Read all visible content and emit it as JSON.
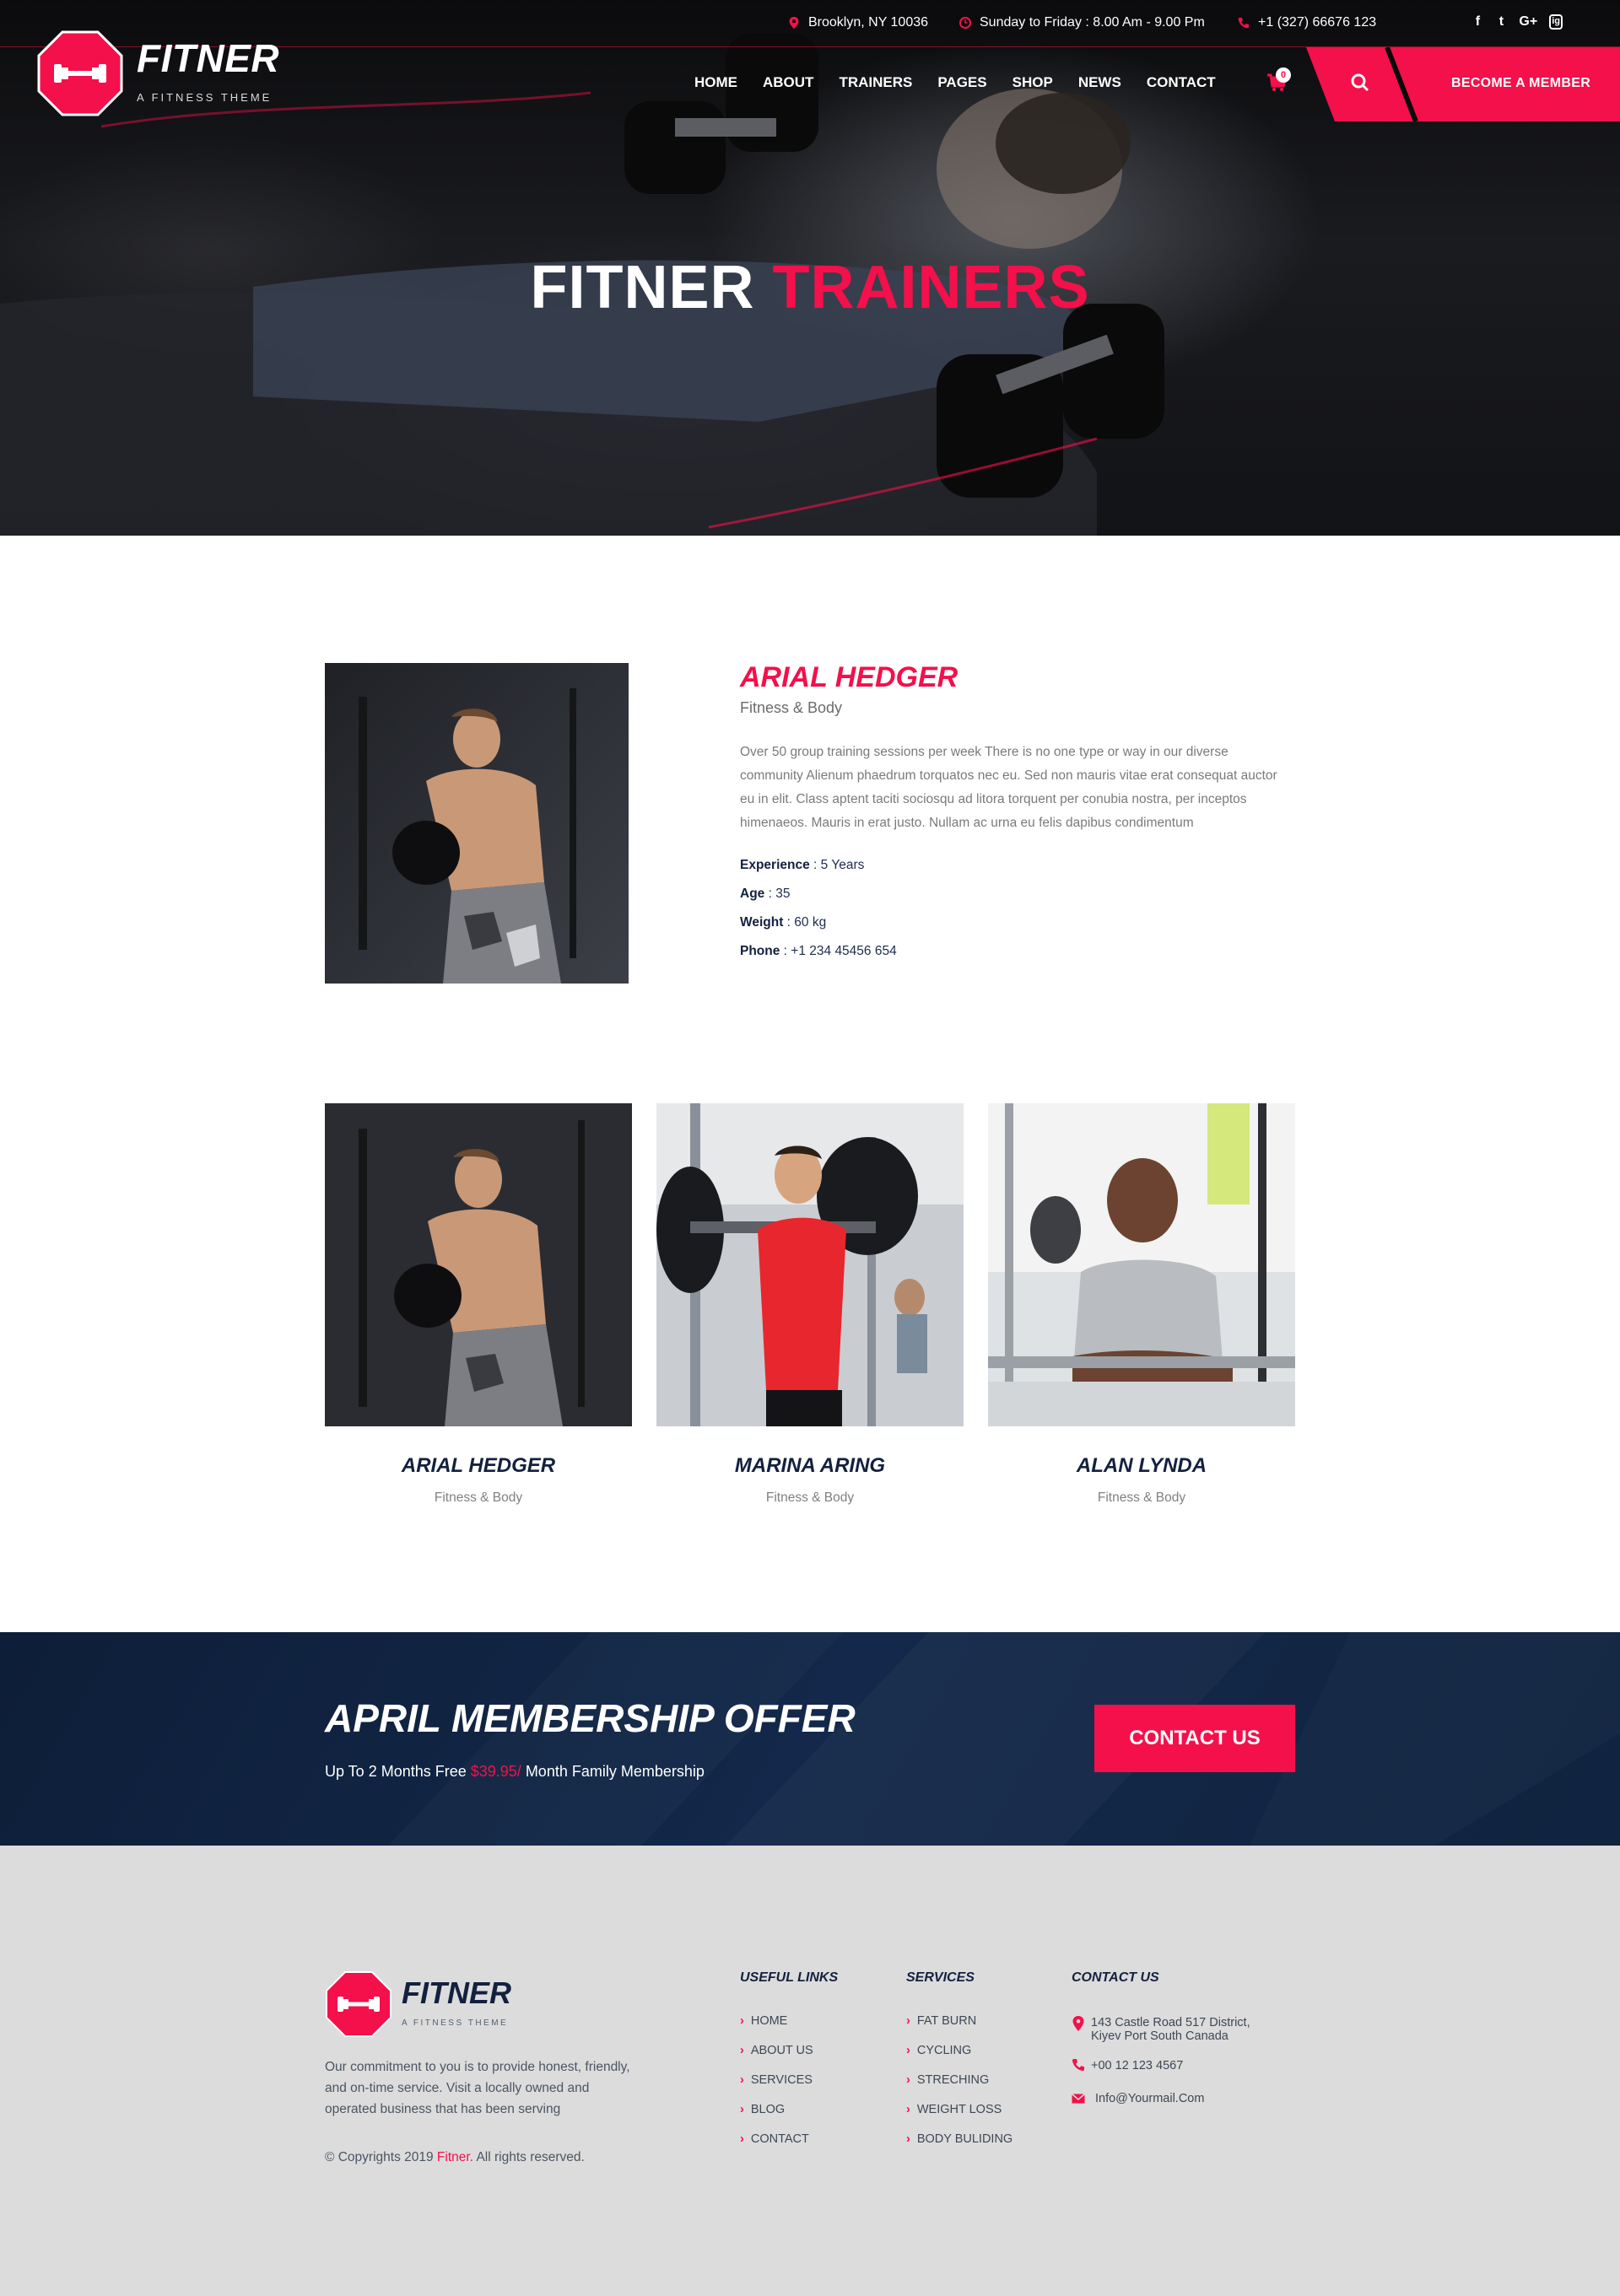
{
  "topbar": {
    "location": "Brooklyn, NY 10036",
    "hours": "Sunday to Friday : 8.00 Am - 9.00 Pm",
    "phone": "+1 (327) 66676 123",
    "social": [
      "f",
      "t",
      "G+",
      "ig"
    ]
  },
  "brand": {
    "name": "FITNER",
    "tagline": "A FITNESS THEME"
  },
  "nav": {
    "items": [
      "HOME",
      "ABOUT",
      "TRAINERS",
      "PAGES",
      "SHOP",
      "NEWS",
      "CONTACT"
    ],
    "cart_count": "0",
    "cta": "BECOME A MEMBER"
  },
  "hero": {
    "title_white": "FITNER",
    "title_red": "TRAINERS"
  },
  "featured": {
    "name": "ARIAL HEDGER",
    "role": "Fitness & Body",
    "description": "Over 50 group training sessions per week There is no one type or way in our diverse community Alienum phaedrum torquatos nec eu. Sed non mauris vitae erat consequat auctor eu in elit. Class aptent taciti sociosqu ad litora torquent per conubia nostra, per inceptos himenaeos. Mauris in erat justo. Nullam ac urna eu felis dapibus condimentum",
    "attributes": [
      {
        "label": "Experience",
        "value": " : 5 Years"
      },
      {
        "label": "Age",
        "value": " : 35"
      },
      {
        "label": "Weight",
        "value": " : 60 kg"
      },
      {
        "label": "Phone",
        "value": " : +1 234 45456 654"
      }
    ]
  },
  "trainers": [
    {
      "name": "ARIAL HEDGER",
      "role": "Fitness & Body"
    },
    {
      "name": "MARINA ARING",
      "role": "Fitness & Body"
    },
    {
      "name": "ALAN LYNDA",
      "role": "Fitness & Body"
    }
  ],
  "offer": {
    "title": "APRIL MEMBERSHIP OFFER",
    "sub_before": "Up To 2 Months Free ",
    "price": "$39.95/",
    "sub_after": " Month Family Membership",
    "button": "CONTACT US"
  },
  "footer": {
    "brand": "FITNER",
    "tagline": "A FITNESS THEME",
    "about": "Our commitment to you is to provide honest, friendly, and on-time service. Visit a locally owned and operated business that has been serving",
    "copy_before": "© Copyrights 2019 ",
    "copy_brand": "Fitner.",
    "copy_after": " All rights reserved.",
    "useful_links_title": "USEFUL LINKS",
    "useful_links": [
      "HOME",
      "ABOUT US",
      "SERVICES",
      "BLOG",
      "CONTACT"
    ],
    "services_title": "SERVICES",
    "services": [
      "FAT BURN",
      "CYCLING",
      "STRECHING",
      "WEIGHT LOSS",
      "BODY BULIDING"
    ],
    "contact_title": "CONTACT US",
    "address_line1": "143 Castle Road 517 District,",
    "address_line2": "Kiyev Port South Canada",
    "phone": "+00 12 123 4567",
    "email": "Info@Yourmail.Com"
  },
  "colors": {
    "accent": "#f4104a",
    "navy": "#13213f",
    "offer_bg": "#10233f",
    "footer_bg": "#dcdcdc"
  }
}
